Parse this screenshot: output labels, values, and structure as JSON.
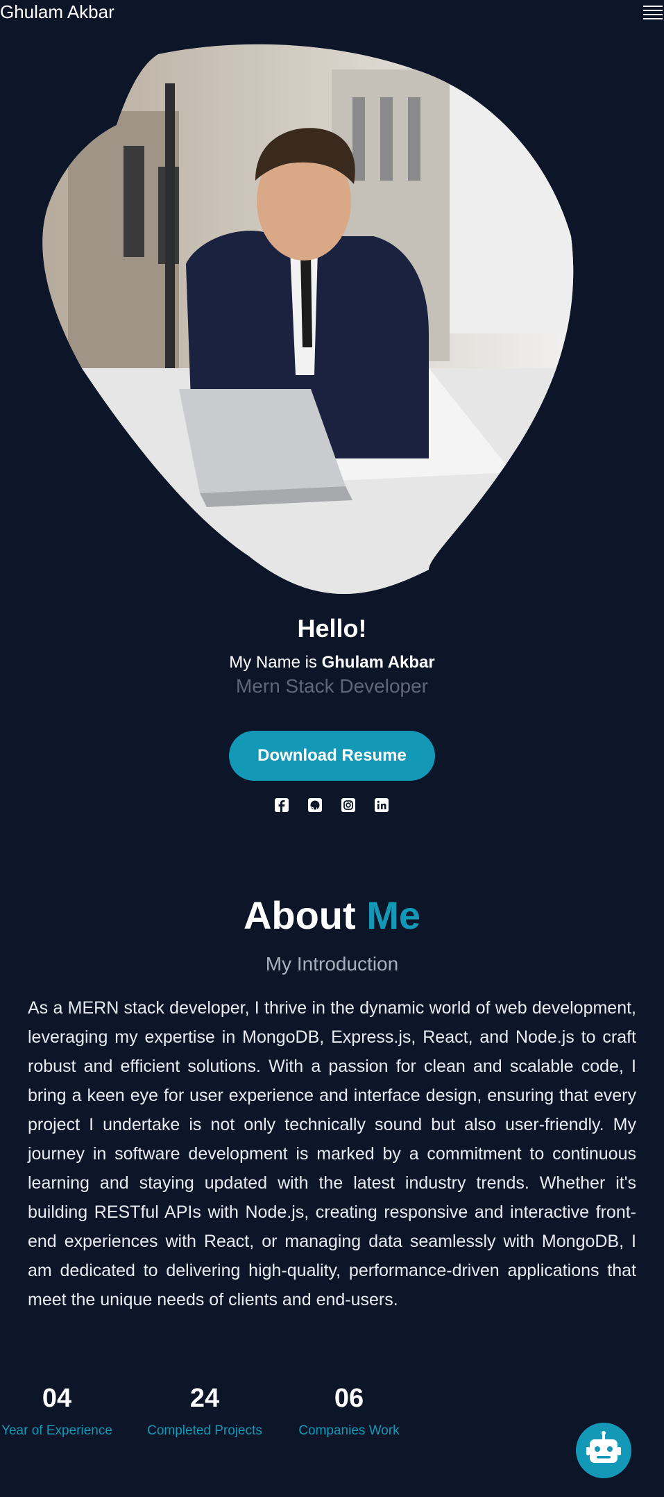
{
  "header": {
    "brand": "Ghulam Akbar",
    "menu_icon": "hamburger-menu-icon"
  },
  "hero": {
    "greeting": "Hello!",
    "name_prefix": "My Name is ",
    "name": "Ghulam Akbar",
    "role": "Mern Stack Developer",
    "resume_button": "Download Resume",
    "social_icons": [
      "facebook-icon",
      "github-icon",
      "instagram-icon",
      "linkedin-icon"
    ]
  },
  "about": {
    "title_main": "About",
    "title_accent": "Me",
    "subtitle": "My Introduction",
    "bio": "As a MERN stack developer, I thrive in the dynamic world of web development, leveraging my expertise in MongoDB, Express.js, React, and Node.js to craft robust and efficient solutions. With a passion for clean and scalable code, I bring a keen eye for user experience and interface design, ensuring that every project I undertake is not only technically sound but also user-friendly. My journey in software development is marked by a commitment to continuous learning and staying updated with the latest industry trends. Whether it's building RESTful APIs with Node.js, creating responsive and interactive front-end experiences with React, or managing data seamlessly with MongoDB, I am dedicated to delivering high-quality, performance-driven applications that meet the unique needs of clients and end-users."
  },
  "stats": [
    {
      "value": "04",
      "label": "Year of Experience"
    },
    {
      "value": "24",
      "label": "Completed Projects"
    },
    {
      "value": "06",
      "label": "Companies Work"
    }
  ],
  "chatbot_icon": "robot-icon",
  "colors": {
    "background": "#0d1629",
    "accent": "#1498b7",
    "muted": "#5f6677"
  }
}
